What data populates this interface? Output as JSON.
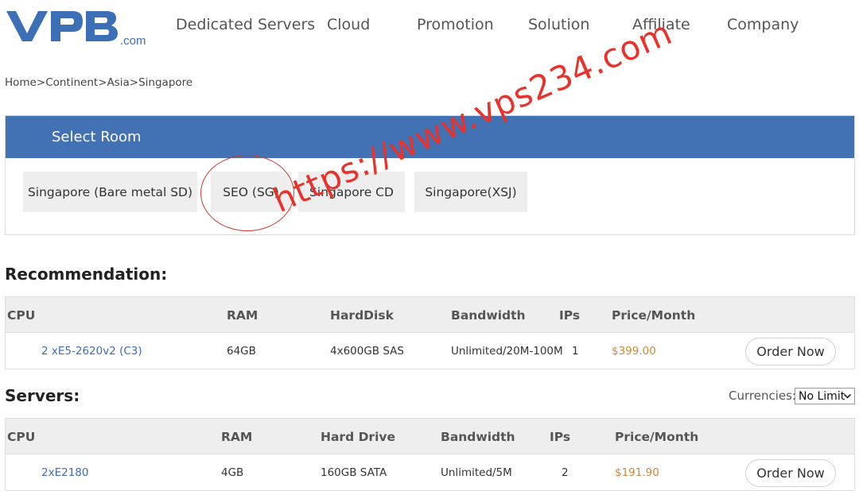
{
  "header": {
    "logo_suffix": ".com",
    "nav": [
      "Dedicated Servers",
      "Cloud",
      "Promotion",
      "Solution",
      "Affiliate",
      "Company"
    ]
  },
  "breadcrumb": {
    "items": [
      "Home",
      "Continent",
      "Asia",
      "Singapore"
    ],
    "separator": ">"
  },
  "rooms": {
    "title": "Select Room",
    "tabs": [
      "Singapore (Bare metal SD)",
      "SEO (SG)",
      "Singapore CD",
      "Singapore(XSJ)"
    ],
    "highlighted_tab": "SEO (SG)",
    "highlight_color": "#cc3b33"
  },
  "recommendation": {
    "title": "Recommendation:",
    "columns": [
      "CPU",
      "RAM",
      "HardDisk",
      "Bandwidth",
      "IPs",
      "Price/Month"
    ],
    "rows": [
      {
        "cpu": "2 xE5-2620v2 (C3)",
        "ram": "64GB",
        "disk": "4x600GB SAS",
        "bandwidth": "Unlimited/20M-100M",
        "ips": "1",
        "price": "$399.00",
        "action": "Order Now"
      }
    ]
  },
  "servers": {
    "title": "Servers:",
    "currency_label": "Currencies:",
    "currency_value": "No Limit",
    "columns": [
      "CPU",
      "RAM",
      "Hard Drive",
      "Bandwidth",
      "IPs",
      "Price/Month"
    ],
    "rows": [
      {
        "cpu": "2xE2180",
        "ram": "4GB",
        "disk": "160GB SATA",
        "bandwidth": "Unlimited/5M",
        "ips": "2",
        "price": "$191.90",
        "action": "Order Now"
      }
    ]
  },
  "watermark": "https://www.vps234.com",
  "colors": {
    "brand_blue": "#4271b4",
    "link_blue": "#3f6bb0",
    "price_orange": "#c88a3a",
    "watermark_red": "#e8332c"
  }
}
